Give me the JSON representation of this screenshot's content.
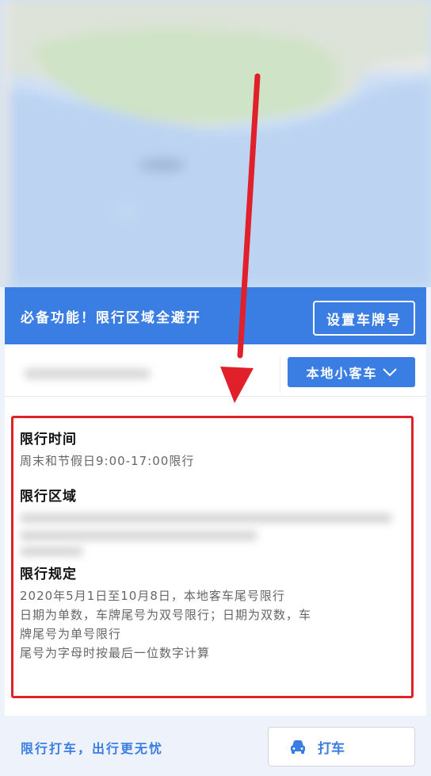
{
  "banner": {
    "text": "必备功能！限行区域全避开",
    "set_plate_label": "设置车牌号"
  },
  "city_row": {
    "vehicle_type": "本地小客车"
  },
  "restriction": {
    "time_title": "限行时间",
    "time_value": "周末和节假日9:00-17:00限行",
    "area_title": "限行区域",
    "rule_title": "限行规定",
    "rule_lines": [
      "2020年5月1日至10月8日，本地客车尾号限行",
      "日期为单数，车牌尾号为双号限行；日期为双数，车",
      "牌尾号为单号限行",
      "尾号为字母时按最后一位数字计算"
    ]
  },
  "footer": {
    "slogan": "限行打车，出行更无忧",
    "taxi_label": "打车"
  },
  "colors": {
    "accent": "#3a7de3",
    "highlight_border": "#e0202a",
    "arrow": "#e0202a"
  }
}
